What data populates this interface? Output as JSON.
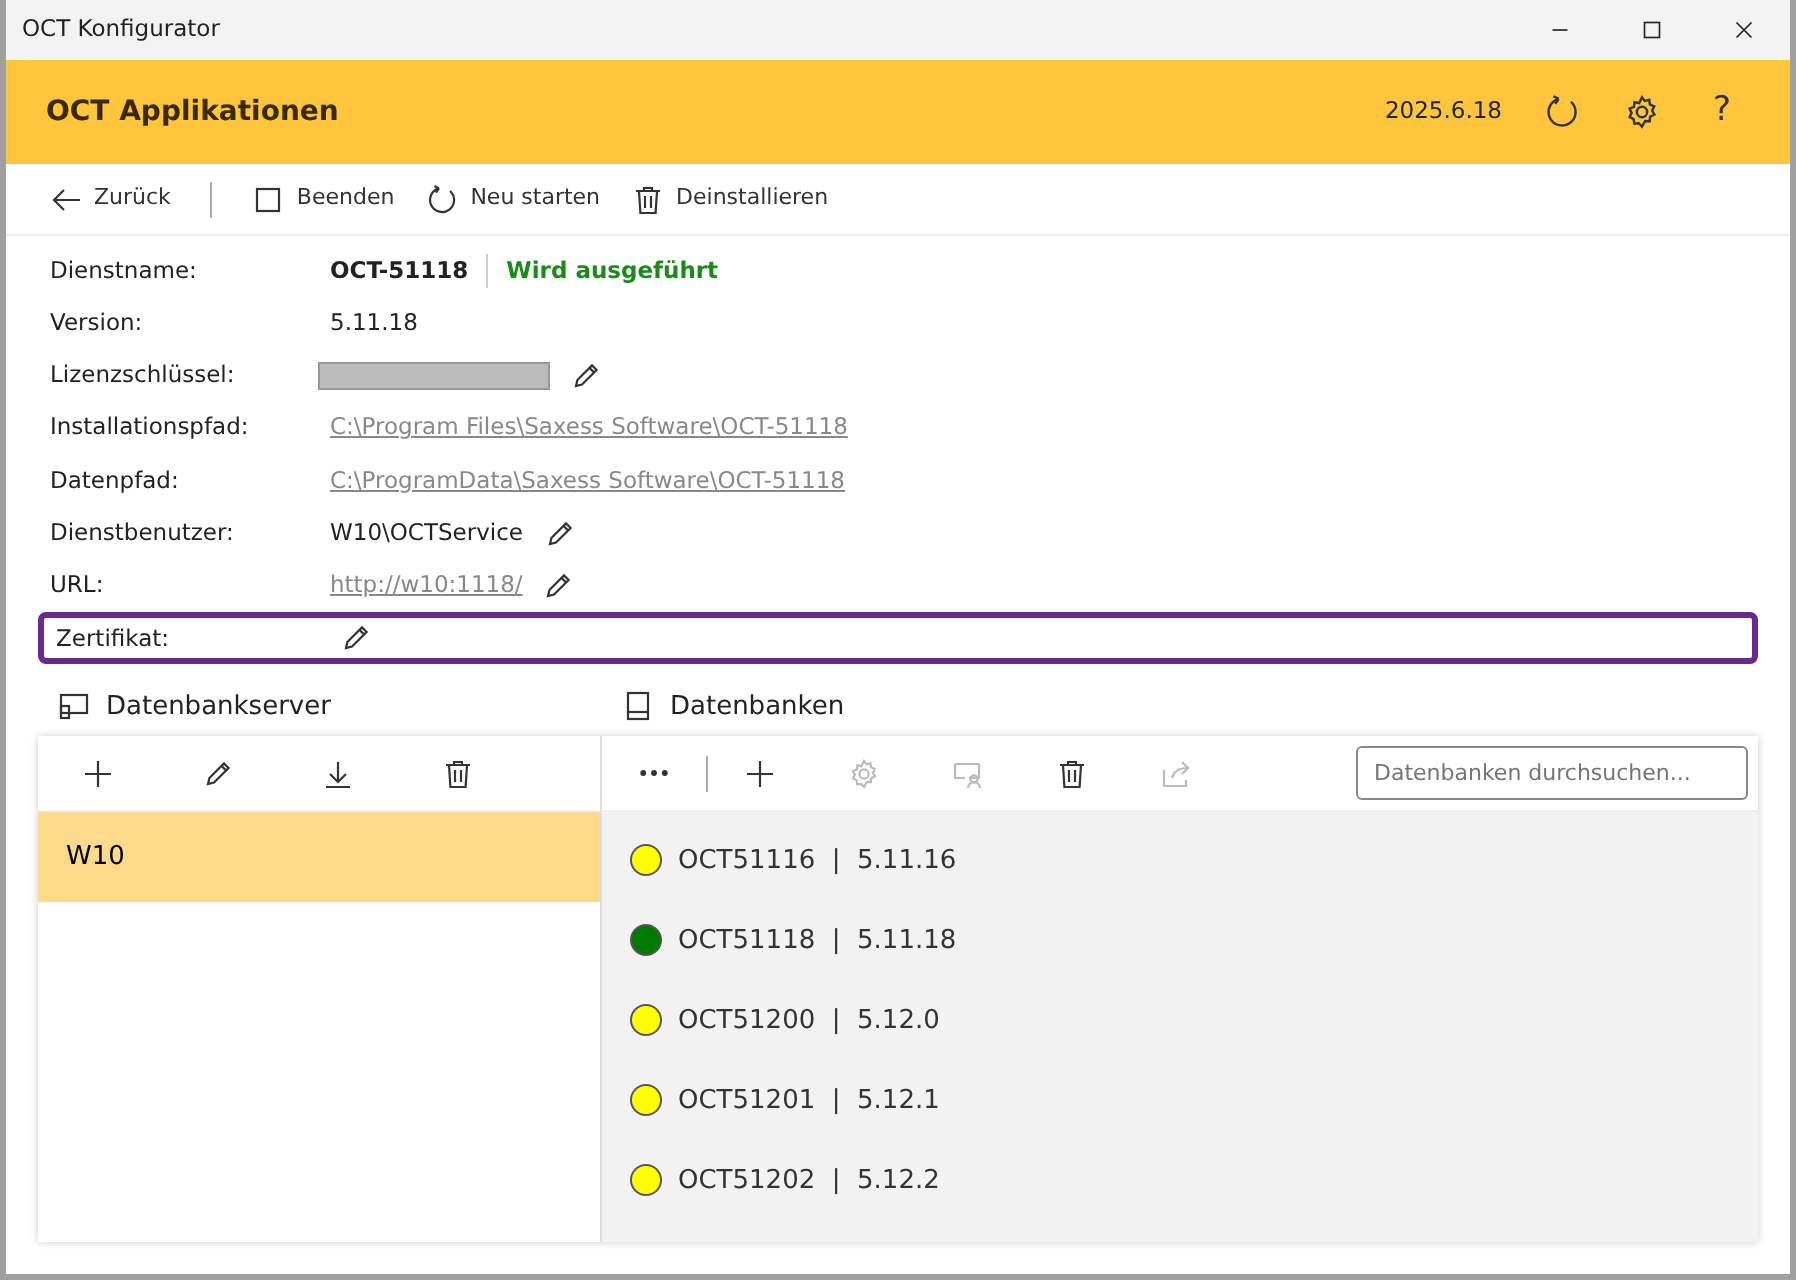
{
  "window": {
    "title": "OCT Konfigurator"
  },
  "header": {
    "title": "OCT Applikationen",
    "version": "2025.6.18",
    "help": "?"
  },
  "toolbar": [
    {
      "label": "Zurück"
    },
    {
      "label": "Beenden"
    },
    {
      "label": "Neu starten"
    },
    {
      "label": "Deinstallieren"
    }
  ],
  "details": [
    {
      "label": "Dienstname:",
      "value": "OCT-51118",
      "kind": "bold",
      "status": "Wird ausgeführt",
      "editable": false,
      "focused": false
    },
    {
      "label": "Version:",
      "value": "5.11.18",
      "kind": "text",
      "editable": false,
      "focused": false
    },
    {
      "label": "Lizenzschlüssel:",
      "kind": "masked",
      "editable": true,
      "focused": false
    },
    {
      "label": "Installationspfad:",
      "value": "C:\\Program Files\\Saxess Software\\OCT-51118",
      "kind": "link",
      "editable": false,
      "focused": false
    },
    {
      "label": "Datenpfad:",
      "value": "C:\\ProgramData\\Saxess Software\\OCT-51118",
      "kind": "link",
      "editable": false,
      "focused": false
    },
    {
      "label": "Dienstbenutzer:",
      "value": "W10\\OCTService",
      "kind": "text",
      "editable": true,
      "focused": false
    },
    {
      "label": "URL:",
      "value": "http://w10:1118/",
      "kind": "link",
      "editable": true,
      "focused": false
    },
    {
      "label": "Zertifikat:",
      "kind": "empty",
      "editable": true,
      "focused": true
    }
  ],
  "servers": {
    "title": "Datenbankserver",
    "items": [
      {
        "label": "W10",
        "selected": true
      }
    ]
  },
  "databases": {
    "title": "Datenbanken",
    "search": {
      "placeholder": "Datenbanken durchsuchen..."
    },
    "tools": [
      {
        "disabled": false
      },
      {
        "disabled": false
      },
      {
        "disabled": true
      },
      {
        "disabled": true
      },
      {
        "disabled": false
      },
      {
        "disabled": true
      }
    ],
    "items": [
      {
        "label": "OCT51116  |  5.11.16",
        "color": "#ffff00"
      },
      {
        "label": "OCT51118  |  5.11.18",
        "color": "#007a00"
      },
      {
        "label": "OCT51200  |  5.12.0",
        "color": "#ffff00"
      },
      {
        "label": "OCT51201  |  5.12.1",
        "color": "#ffff00"
      },
      {
        "label": "OCT51202  |  5.12.2",
        "color": "#ffff00"
      }
    ]
  }
}
